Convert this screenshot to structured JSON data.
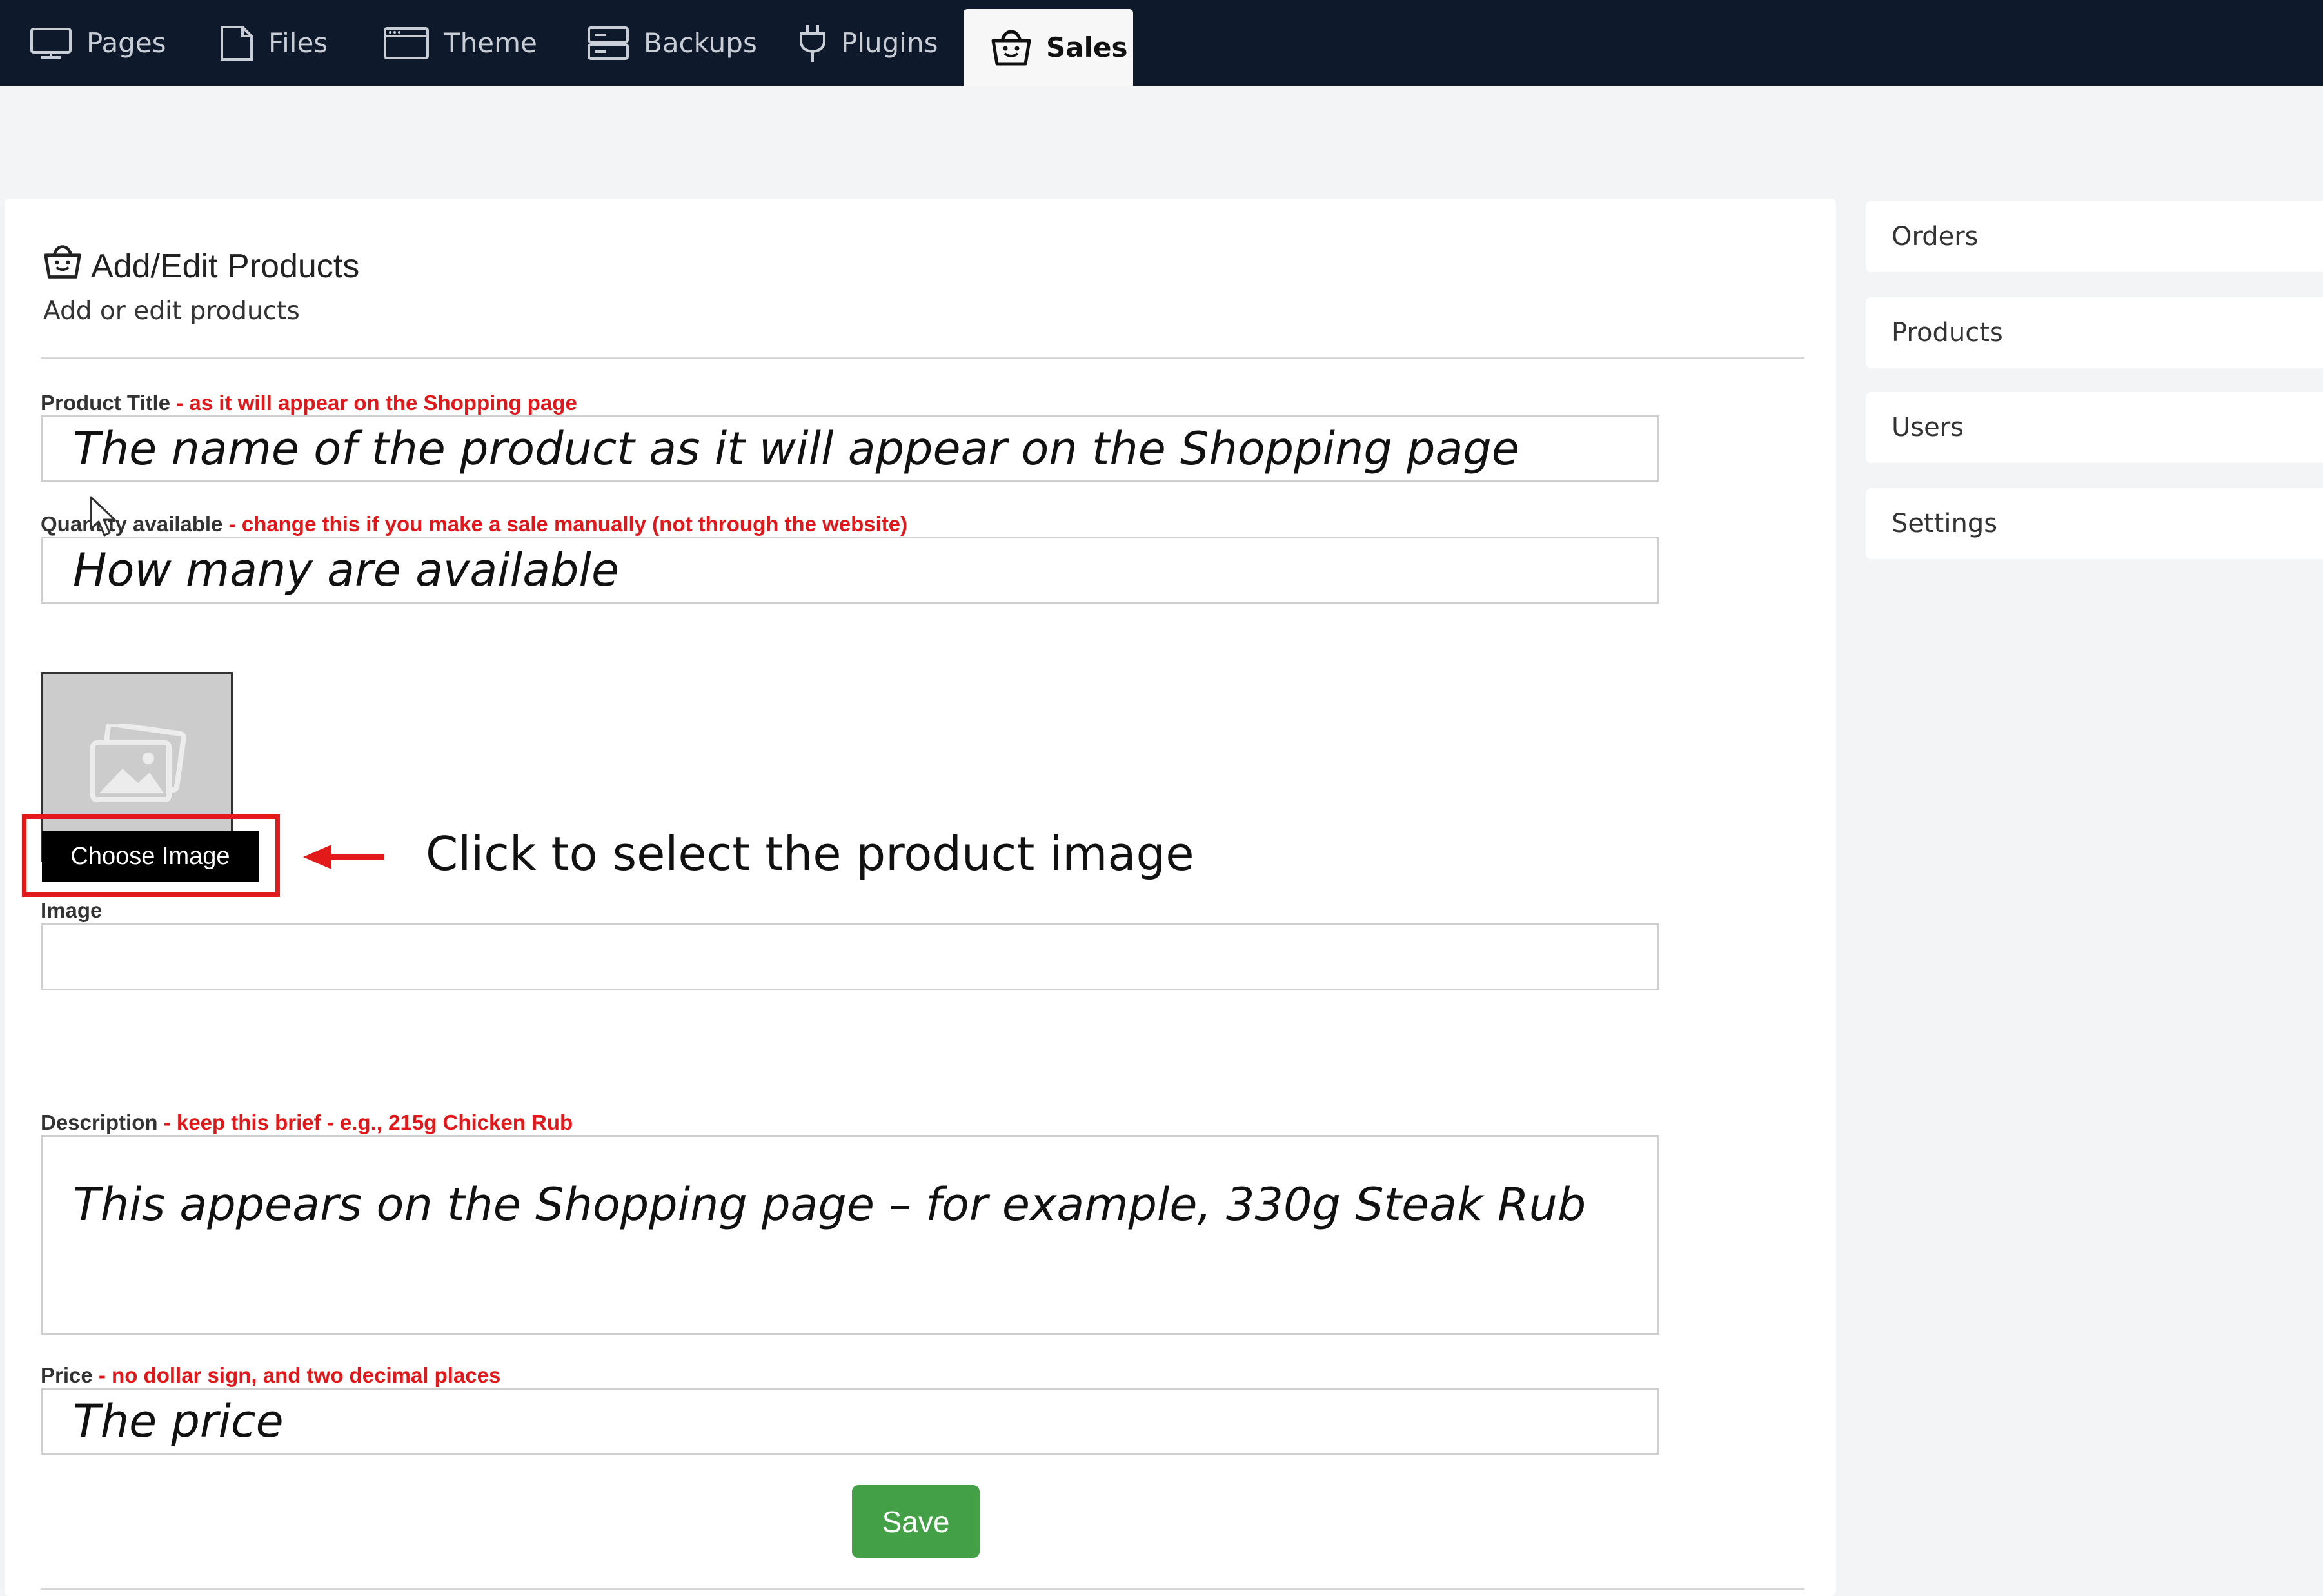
{
  "nav": {
    "tabs": [
      {
        "label": "Pages",
        "icon": "monitor-icon"
      },
      {
        "label": "Files",
        "icon": "file-icon"
      },
      {
        "label": "Theme",
        "icon": "browser-window-icon"
      },
      {
        "label": "Backups",
        "icon": "server-icon"
      },
      {
        "label": "Plugins",
        "icon": "plug-icon"
      },
      {
        "label": "Sales",
        "icon": "shopping-basket-icon",
        "active": true
      }
    ]
  },
  "header": {
    "title": "Add/Edit Products",
    "subtitle": "Add or edit products",
    "icon": "shopping-basket-icon"
  },
  "form": {
    "title_label": "Product Title",
    "title_hint": " - as it will appear on the Shopping page",
    "title_value": "The name of the product as it will appear on the Shopping page",
    "qty_label": "Quantity available",
    "qty_hint": " - change this if you make a sale manually (not through the website)",
    "qty_value": "How many are available",
    "image_label": "Image",
    "image_value": "",
    "image_placeholder_icon": "image-placeholder-icon",
    "choose_image_label": "Choose Image",
    "desc_label": "Description",
    "desc_hint": " - keep this brief - e.g., 215g Chicken Rub",
    "desc_value": "This appears on the Shopping page – for example, 330g Steak Rub",
    "price_label": "Price",
    "price_hint": " - no dollar sign, and two decimal places",
    "price_value": "The price",
    "save_label": "Save"
  },
  "annotation": {
    "text": "Click to select the product image",
    "color": "#e31a1a"
  },
  "sidebar": {
    "items": [
      {
        "label": "Orders"
      },
      {
        "label": "Products"
      },
      {
        "label": "Users"
      },
      {
        "label": "Settings"
      }
    ]
  },
  "colors": {
    "topbar": "#0e1a2b",
    "hint_red": "#e3171a",
    "save_green": "#43a047"
  }
}
